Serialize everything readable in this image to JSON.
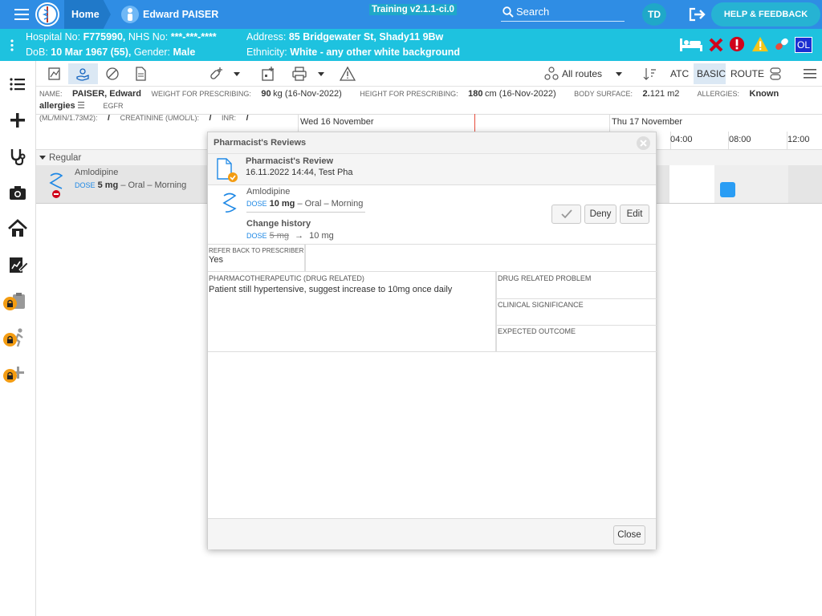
{
  "topbar": {
    "home": "Home",
    "patient_name": "Edward PAISER",
    "training": "Training v2.1.1-ci.0",
    "search": "Search",
    "avatar": "TD",
    "help": "HELP & FEEDBACK"
  },
  "patient_bar": {
    "hospital_no_label": "Hospital No:",
    "hospital_no": "F775990,",
    "nhs_label": "NHS No:",
    "nhs": "***-***-****",
    "dob_label": "DoB:",
    "dob": "10 Mar 1967 (55),",
    "gender_label": "Gender:",
    "gender": "Male",
    "address_label": "Address:",
    "address": "85 Bridgewater St, Shady11 9Bw",
    "ethnicity_label": "Ethnicity:",
    "ethnicity": "White - any other white background",
    "ol_badge": "OL"
  },
  "toolbar": {
    "all_routes": "All routes",
    "atc": "ATC",
    "basic": "BASIC",
    "route": "ROUTE"
  },
  "info": {
    "name_label": "NAME:",
    "name": "PAISER, Edward",
    "weight_label": "WEIGHT FOR PRESCRIBING:",
    "weight_val": "90",
    "weight_unit": "kg (16-Nov-2022)",
    "height_label": "HEIGHT FOR PRESCRIBING:",
    "height_val": "180",
    "height_unit": "cm (16-Nov-2022)",
    "bsa_label": "BODY SURFACE:",
    "bsa_val": "2.",
    "bsa_rest": "121 m2",
    "allergies_label": "ALLERGIES:",
    "allergies": "Known allergies",
    "egfr_label": "EGFR",
    "egfr_unit": "(ML/MIN/1.73M2):",
    "egfr_val": "/",
    "creat_label": "CREATININE (UMOL/L):",
    "creat_val": "/",
    "inr_label": "INR:",
    "inr_val": "/"
  },
  "timeline": {
    "day1": "Wed 16 November",
    "day2": "Thu 17 November",
    "t1": "04:00",
    "t2": "08:00",
    "t3": "12:00"
  },
  "regular": "Regular",
  "med": {
    "name": "Amlodipine",
    "dose_label": "DOSE",
    "dose": "5 mg",
    "route": "– Oral – Morning"
  },
  "modal": {
    "title": "Pharmacist's Reviews",
    "review_title": "Pharmacist's Review",
    "review_meta": "16.11.2022 14:44, Test Pha",
    "med_name": "Amlodipine",
    "dose_label": "DOSE",
    "dose": "10 mg",
    "route": "– Oral – Morning",
    "change_history": "Change history",
    "old_dose": "5 mg",
    "new_dose": "10 mg",
    "deny": "Deny",
    "edit": "Edit",
    "refer_label": "REFER BACK TO PRESCRIBER",
    "refer_value": "Yes",
    "pharma_label": "PHARMACOTHERAPEUTIC (DRUG RELATED)",
    "pharma_value": "Patient still hypertensive, suggest increase to 10mg once daily",
    "drp_label": "DRUG RELATED PROBLEM",
    "clin_label": "CLINICAL SIGNIFICANCE",
    "outcome_label": "EXPECTED OUTCOME",
    "close": "Close"
  }
}
